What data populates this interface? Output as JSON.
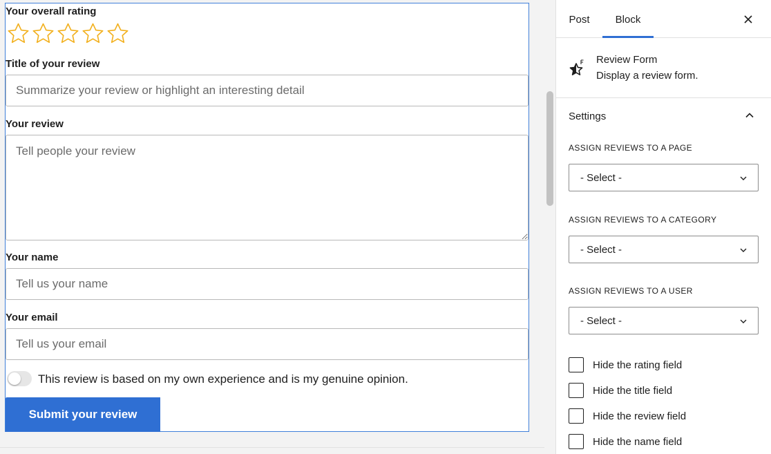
{
  "form": {
    "rating_label": "Your overall rating",
    "rating_value": 0,
    "rating_max": 5,
    "title_label": "Title of your review",
    "title_placeholder": "Summarize your review or highlight an interesting detail",
    "review_label": "Your review",
    "review_placeholder": "Tell people your review",
    "name_label": "Your name",
    "name_placeholder": "Tell us your name",
    "email_label": "Your email",
    "email_placeholder": "Tell us your email",
    "consent_text": "This review is based on my own experience and is my genuine opinion.",
    "consent_on": false,
    "submit_label": "Submit your review"
  },
  "sidebar": {
    "tabs": [
      {
        "label": "Post",
        "active": false
      },
      {
        "label": "Block",
        "active": true
      }
    ],
    "close_icon": "close-icon",
    "block": {
      "icon": "star-icon",
      "title": "Review Form",
      "description": "Display a review form."
    },
    "settings": {
      "title": "Settings",
      "expanded": true,
      "assign_page_label": "ASSIGN REVIEWS TO A PAGE",
      "assign_page_value": "- Select -",
      "assign_category_label": "ASSIGN REVIEWS TO A CATEGORY",
      "assign_category_value": "- Select -",
      "assign_user_label": "ASSIGN REVIEWS TO A USER",
      "assign_user_value": "- Select -",
      "checkboxes": [
        {
          "label": "Hide the rating field",
          "checked": false
        },
        {
          "label": "Hide the title field",
          "checked": false
        },
        {
          "label": "Hide the review field",
          "checked": false
        },
        {
          "label": "Hide the name field",
          "checked": false
        }
      ]
    }
  },
  "colors": {
    "accent": "#2f6fd3",
    "star": "#f2b01e",
    "block_outline": "#3f7fd9"
  }
}
